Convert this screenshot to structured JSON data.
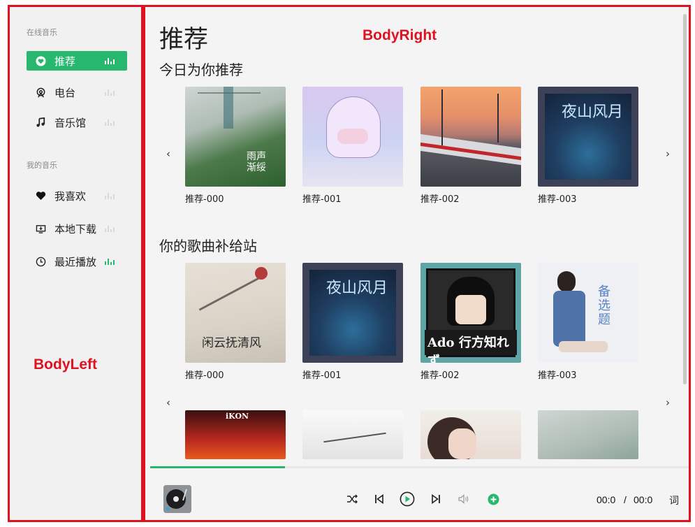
{
  "annotations": {
    "left": "BodyLeft",
    "right": "BodyRight"
  },
  "sidebar": {
    "online_label": "在线音乐",
    "online_items": [
      {
        "label": "推荐",
        "icon": "heart-circle-icon",
        "active": true
      },
      {
        "label": "电台",
        "icon": "radio-icon",
        "active": false
      },
      {
        "label": "音乐馆",
        "icon": "music-note-icon",
        "active": false
      }
    ],
    "mine_label": "我的音乐",
    "mine_items": [
      {
        "label": "我喜欢",
        "icon": "heart-icon",
        "active": false
      },
      {
        "label": "本地下载",
        "icon": "download-icon",
        "active": false
      },
      {
        "label": "最近播放",
        "icon": "clock-icon",
        "active": false,
        "playing": true
      }
    ]
  },
  "main": {
    "page_title": "推荐",
    "rows": [
      {
        "title": "今日为你推荐",
        "cards": [
          {
            "caption": "推荐-000",
            "cover_text": "雨声\n渐绥"
          },
          {
            "caption": "推荐-001"
          },
          {
            "caption": "推荐-002"
          },
          {
            "caption": "推荐-003",
            "cover_text": "夜山风月"
          }
        ]
      },
      {
        "title": "你的歌曲补给站",
        "cards": [
          {
            "caption": "推荐-000",
            "cover_text": "闲云抚清风"
          },
          {
            "caption": "推荐-001",
            "cover_text": "夜山风月"
          },
          {
            "caption": "推荐-002",
            "cover_text": "Ado 行方知れず"
          },
          {
            "caption": "推荐-003",
            "cover_text": "备选题"
          }
        ]
      }
    ],
    "third_row_covers": [
      {
        "cover_text": "iKON"
      },
      {
        "cover_text": ""
      },
      {
        "cover_text": ""
      },
      {
        "cover_text": ""
      }
    ]
  },
  "player": {
    "progress": 0.25,
    "current_time": "00:0",
    "separator": "/",
    "total_time": "00:0",
    "lyric_label": "词"
  },
  "colors": {
    "accent": "#28b76f",
    "annotation": "#e0121f"
  }
}
